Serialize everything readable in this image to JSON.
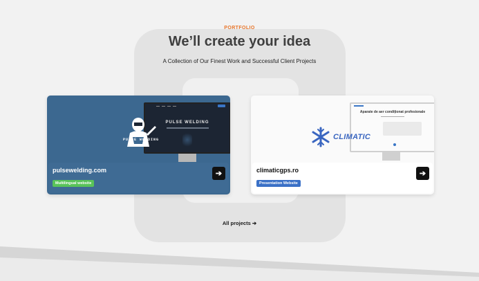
{
  "header": {
    "eyebrow": "PORTFOLIO",
    "title": "We’ll create your idea",
    "subtitle": "A Collection of Our Finest Work and Successful Client Projects"
  },
  "projects": [
    {
      "domain": "pulsewelding.com",
      "badge": "Multilingual website",
      "logo_text": "PULSE WELDING",
      "screenshot_title": "PULSE WELDING",
      "arrow": "➔",
      "badge_color": "#59c359",
      "card_color": "#3c6890"
    },
    {
      "domain": "climaticgps.ro",
      "badge": "Presentation Website",
      "logo_text": "CLIMATIC",
      "screenshot_title": "Aparate de aer condiționat profesionale",
      "arrow": "➔",
      "badge_color": "#3a70c6",
      "card_color": "#fafafa"
    }
  ],
  "footer": {
    "all_projects": "All projects ➔"
  },
  "colors": {
    "accent": "#e8762b",
    "background": "#f2f2f2"
  },
  "icons": {
    "arrow": "arrow-right-icon",
    "snowflake": "snowflake-icon",
    "welder": "welder-mascot-icon"
  }
}
